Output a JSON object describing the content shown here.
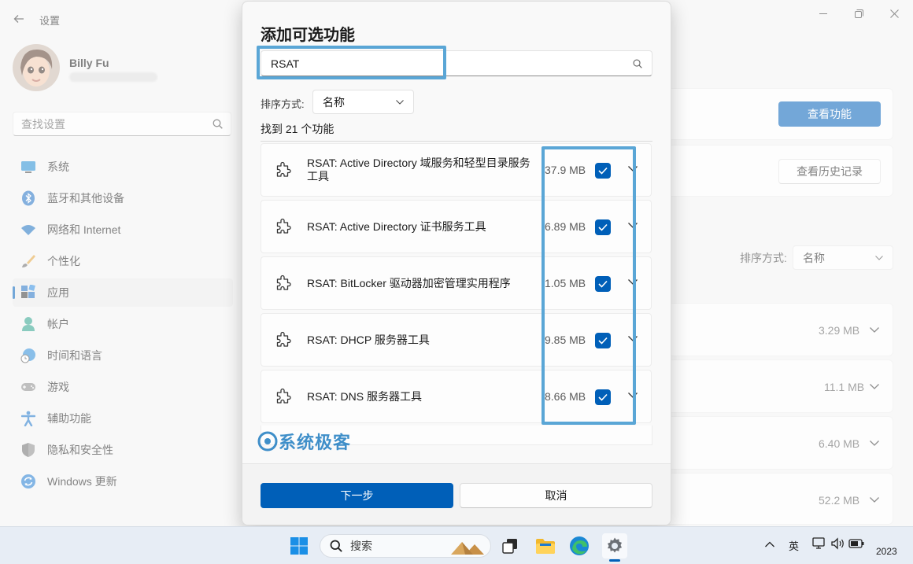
{
  "app": {
    "title": "设置"
  },
  "profile": {
    "name": "Billy Fu"
  },
  "sidebar": {
    "search_placeholder": "查找设置",
    "items": [
      {
        "label": "系统",
        "icon": "monitor-icon"
      },
      {
        "label": "蓝牙和其他设备",
        "icon": "bluetooth-icon"
      },
      {
        "label": "网络和 Internet",
        "icon": "wifi-icon"
      },
      {
        "label": "个性化",
        "icon": "brush-icon"
      },
      {
        "label": "应用",
        "icon": "apps-icon",
        "active": true
      },
      {
        "label": "帐户",
        "icon": "person-icon"
      },
      {
        "label": "时间和语言",
        "icon": "clock-globe-icon"
      },
      {
        "label": "游戏",
        "icon": "gamepad-icon"
      },
      {
        "label": "辅助功能",
        "icon": "accessibility-icon"
      },
      {
        "label": "隐私和安全性",
        "icon": "shield-icon"
      },
      {
        "label": "Windows 更新",
        "icon": "update-icon"
      }
    ]
  },
  "background": {
    "view_features_label": "查看功能",
    "view_history_label": "查看历史记录",
    "sort_label": "排序方式:",
    "sort_value": "名称",
    "installed_sizes": [
      "3.29 MB",
      "11.1 MB",
      "6.40 MB",
      "52.2 MB"
    ]
  },
  "dialog": {
    "title": "添加可选功能",
    "search_value": "RSAT",
    "sort_label": "排序方式:",
    "sort_value": "名称",
    "found_text": "找到 21 个功能",
    "features": [
      {
        "name": "RSAT: Active Directory 域服务和轻型目录服务工具",
        "size": "37.9 MB",
        "checked": true
      },
      {
        "name": "RSAT: Active Directory 证书服务工具",
        "size": "6.89 MB",
        "checked": true
      },
      {
        "name": "RSAT: BitLocker 驱动器加密管理实用程序",
        "size": "1.05 MB",
        "checked": true
      },
      {
        "name": "RSAT: DHCP 服务器工具",
        "size": "9.85 MB",
        "checked": true
      },
      {
        "name": "RSAT: DNS 服务器工具",
        "size": "8.66 MB",
        "checked": true
      }
    ],
    "watermark": "系统极客",
    "next_label": "下一步",
    "cancel_label": "取消"
  },
  "taskbar": {
    "search_label": "搜索",
    "tray": {
      "ime": "英",
      "year": "2023"
    }
  },
  "colors": {
    "accent": "#005fb8",
    "highlight": "#5aa6d6"
  }
}
